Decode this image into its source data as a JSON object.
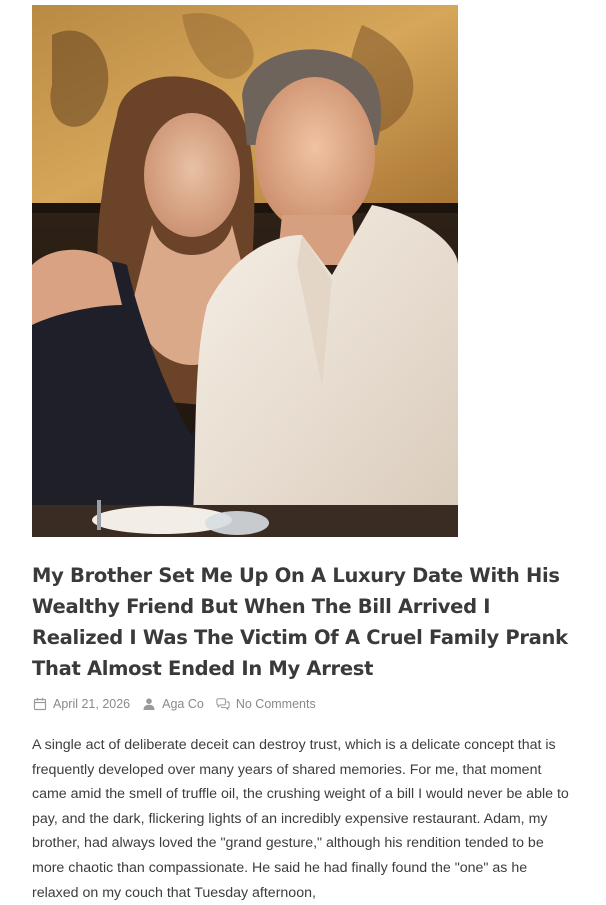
{
  "post": {
    "image_alt": "Woman and man smiling together at a restaurant table",
    "title": "My Brother Set Me Up On A Luxury Date With His Wealthy Friend But When The Bill Arrived I Realized I Was The Victim Of A Cruel Family Prank That Almost Ended In My Arrest",
    "meta": {
      "date": "April 21, 2026",
      "author": "Aga Co",
      "comments": "No Comments"
    },
    "excerpt": "A single act of deliberate deceit can destroy trust, which is a delicate concept that is frequently developed over many years of shared memories. For me, that moment came amid the smell of truffle oil, the crushing weight of a bill I would never be able to pay, and the dark, flickering lights of an incredibly expensive restaurant. Adam, my brother, had always loved the \"grand gesture,\" although his rendition tended to be more chaotic than compassionate. He said he had finally found the \"one\" as he relaxed on my couch that Tuesday afternoon,"
  },
  "icons": {
    "date": "calendar-icon",
    "author": "user-icon",
    "comments": "comments-icon"
  },
  "colors": {
    "title": "#3a3a3a",
    "meta": "#8a8a8a",
    "body": "#3d3d3d"
  }
}
